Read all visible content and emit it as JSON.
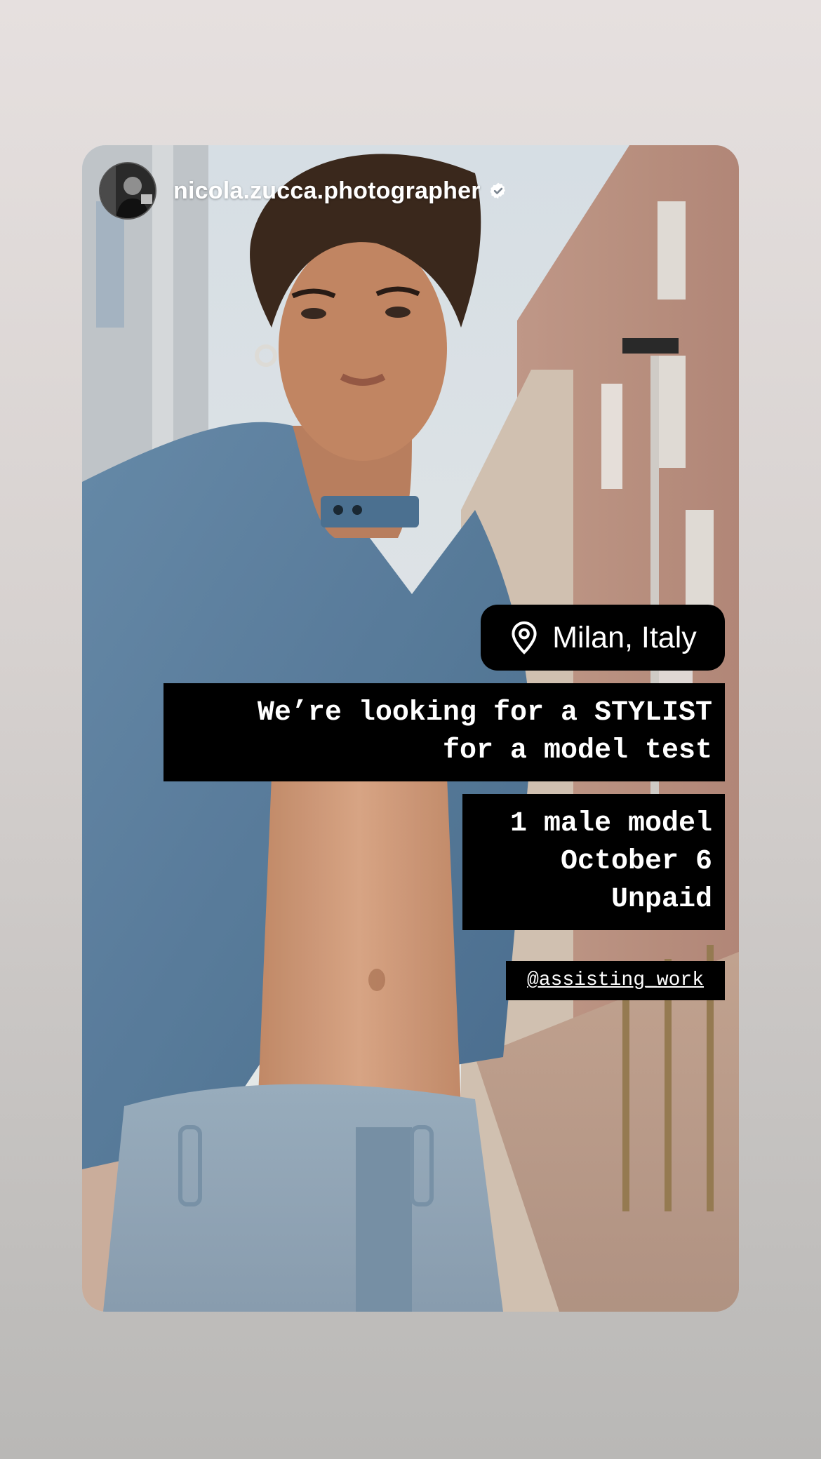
{
  "story": {
    "username": "nicola.zucca.photographer",
    "verified": true,
    "avatar_icon": "profile-photo-avatar",
    "verified_icon": "verified-badge-icon"
  },
  "stickers": {
    "location": {
      "icon": "location-pin-icon",
      "label": "Milan, Italy"
    },
    "headline": "We’re looking for a STYLIST\nfor a model test",
    "details": "1 male model\nOctober 6\nUnpaid",
    "mention": "@assisting_work"
  },
  "colors": {
    "sticker_background": "#000000",
    "sticker_text": "#ffffff",
    "page_background_top": "#e6e0df",
    "page_background_bottom": "#b9b8b6"
  }
}
